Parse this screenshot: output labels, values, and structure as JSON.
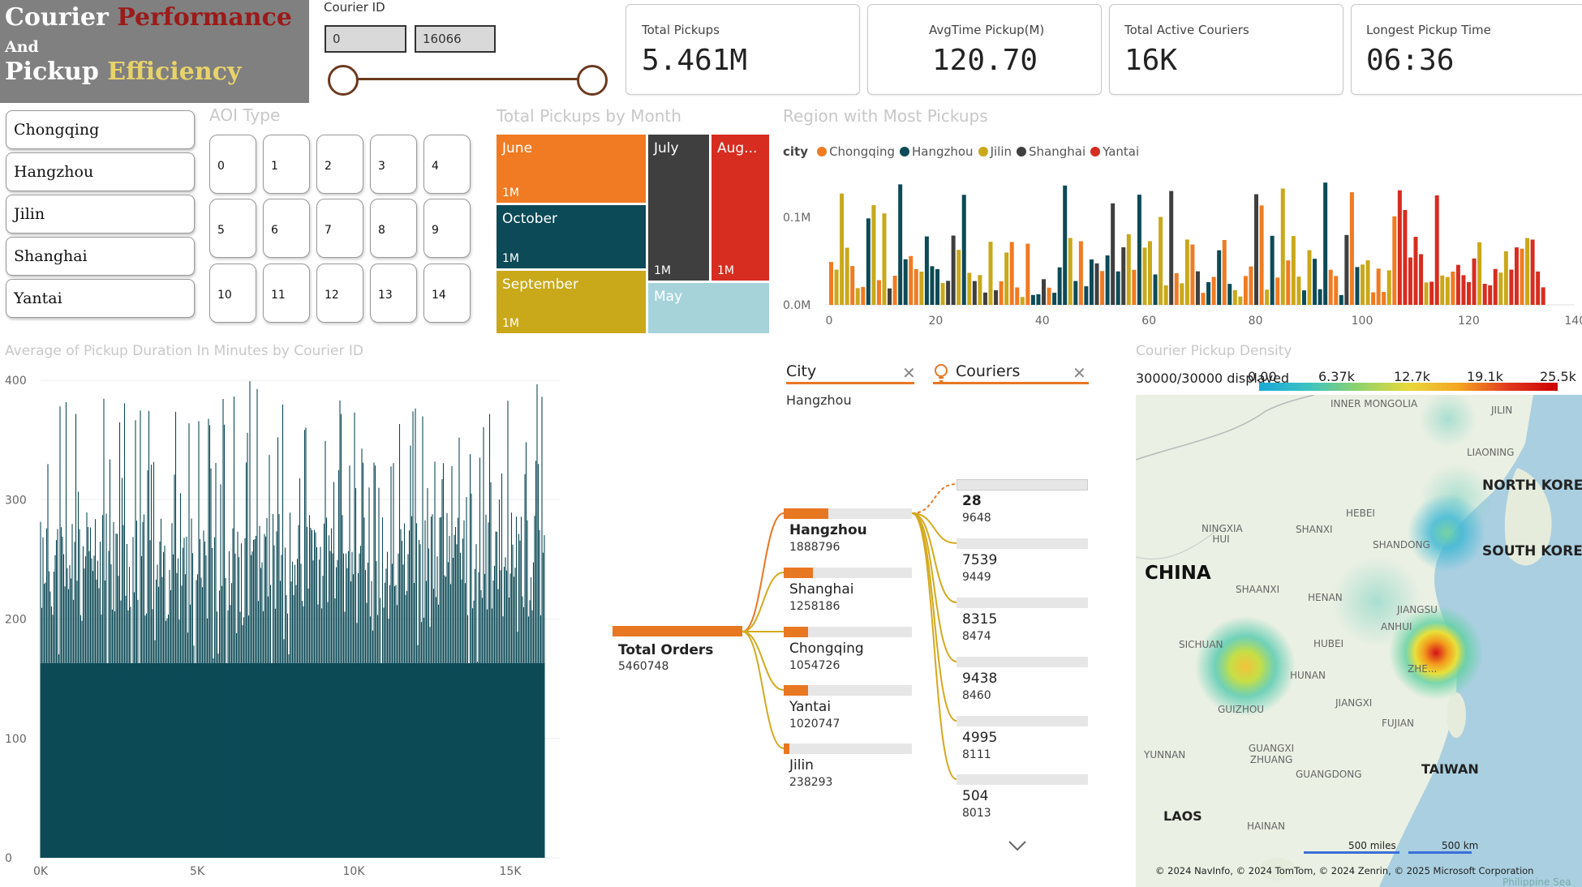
{
  "title": {
    "word1": "Courier",
    "word2": "Performance",
    "word3": "And",
    "word4": "Pickup",
    "word5": "Efficiency"
  },
  "courier_slider": {
    "label": "Courier ID",
    "min": "0",
    "max": "16066"
  },
  "kpis": [
    {
      "label": "Total Pickups",
      "value": "5.461M"
    },
    {
      "label": "AvgTime Pickup(M)",
      "value": "120.70"
    },
    {
      "label": "Total Active Couriers",
      "value": "16K"
    },
    {
      "label": "Longest Pickup Time",
      "value": "06:36"
    }
  ],
  "city_slicer": [
    "Chongqing",
    "Hangzhou",
    "Jilin",
    "Shanghai",
    "Yantai"
  ],
  "aoi": {
    "title": "AOI Type",
    "items": [
      "0",
      "1",
      "2",
      "3",
      "4",
      "5",
      "6",
      "7",
      "8",
      "9",
      "10",
      "11",
      "12",
      "13",
      "14"
    ]
  },
  "treemap": {
    "title": "Total Pickups by Month",
    "cells": [
      {
        "label": "June",
        "value": "1M",
        "color": "#f07b22"
      },
      {
        "label": "October",
        "value": "1M",
        "color": "#0d4a57"
      },
      {
        "label": "September",
        "value": "1M",
        "color": "#c9a81a"
      },
      {
        "label": "July",
        "value": "1M",
        "color": "#3f3f3f"
      },
      {
        "label": "Aug...",
        "value": "1M",
        "color": "#d62d20"
      },
      {
        "label": "May",
        "value": "",
        "color": "#a6d3da"
      }
    ]
  },
  "region_chart": {
    "title": "Region with Most Pickups",
    "legend_title": "city",
    "legend": [
      {
        "name": "Chongqing",
        "color": "#f07b22"
      },
      {
        "name": "Hangzhou",
        "color": "#0d4a57"
      },
      {
        "name": "Jilin",
        "color": "#c9a81a"
      },
      {
        "name": "Shanghai",
        "color": "#3f3f3f"
      },
      {
        "name": "Yantai",
        "color": "#d62d20"
      }
    ],
    "y_ticks": [
      "0.1M",
      "0.0M"
    ],
    "x_ticks": [
      "0",
      "20",
      "40",
      "60",
      "80",
      "100",
      "120",
      "140"
    ]
  },
  "duration_chart": {
    "title": "Average of Pickup Duration In Minutes by Courier ID",
    "y_ticks": [
      "400",
      "300",
      "200",
      "100",
      "0"
    ],
    "x_ticks": [
      "0K",
      "5K",
      "10K",
      "15K"
    ],
    "color": "#0d4a57"
  },
  "decomp_tree": {
    "header1": "City",
    "header1_value": "Hangzhou",
    "header2": "Couriers",
    "root": {
      "label": "Total Orders",
      "value": "5460748"
    },
    "level1": [
      {
        "label": "Hangzhou",
        "value": "1888796",
        "fraction": 0.35
      },
      {
        "label": "Shanghai",
        "value": "1258186",
        "fraction": 0.23
      },
      {
        "label": "Chongqing",
        "value": "1054726",
        "fraction": 0.19
      },
      {
        "label": "Yantai",
        "value": "1020747",
        "fraction": 0.19
      },
      {
        "label": "Jilin",
        "value": "238293",
        "fraction": 0.04
      }
    ],
    "level2": [
      {
        "label": "28",
        "value": "9648"
      },
      {
        "label": "7539",
        "value": "9449"
      },
      {
        "label": "8315",
        "value": "8474"
      },
      {
        "label": "9438",
        "value": "8460"
      },
      {
        "label": "4995",
        "value": "8111"
      },
      {
        "label": "504",
        "value": "8013"
      }
    ]
  },
  "density_map": {
    "title": "Courier Pickup Density",
    "displayed": "30000/30000 displayed",
    "scale": [
      "0.00",
      "6.37k",
      "12.7k",
      "19.1k",
      "25.5k"
    ],
    "labels": {
      "inner_mongolia": "INNER MONGOLIA",
      "jilin": "JILIN",
      "liaoning": "LIAONING",
      "north_korea": "NORTH KOREA",
      "south_korea": "SOUTH KOREA",
      "hebei": "HEBEI",
      "ningxia": "NINGXIA HUI",
      "shanxi": "SHANXI",
      "shandong": "SHANDONG",
      "china": "CHINA",
      "shaanxi": "SHAANXI",
      "henan": "HENAN",
      "jiangsu": "JIANGSU",
      "anhui": "ANHUI",
      "sichuan": "SICHUAN",
      "hubei": "HUBEI",
      "zhejiang": "ZHE...",
      "hunan": "HUNAN",
      "guizhou": "GUIZHOU",
      "jiangxi": "JIANGXI",
      "fujian": "FUJIAN",
      "yunnan": "YUNNAN",
      "guangxi": "GUANGXI ZHUANG",
      "guangdong": "GUANGDONG",
      "taiwan": "TAIWAN",
      "laos": "LAOS",
      "hainan": "HAINAN",
      "philippine_sea": "Philippine Sea"
    },
    "scale_miles": "500 miles",
    "scale_km": "500 km",
    "copyright": "© 2024 NavInfo, © 2024 TomTom, © 2024 Zenrin, © 2025 Microsoft Corporation"
  }
}
